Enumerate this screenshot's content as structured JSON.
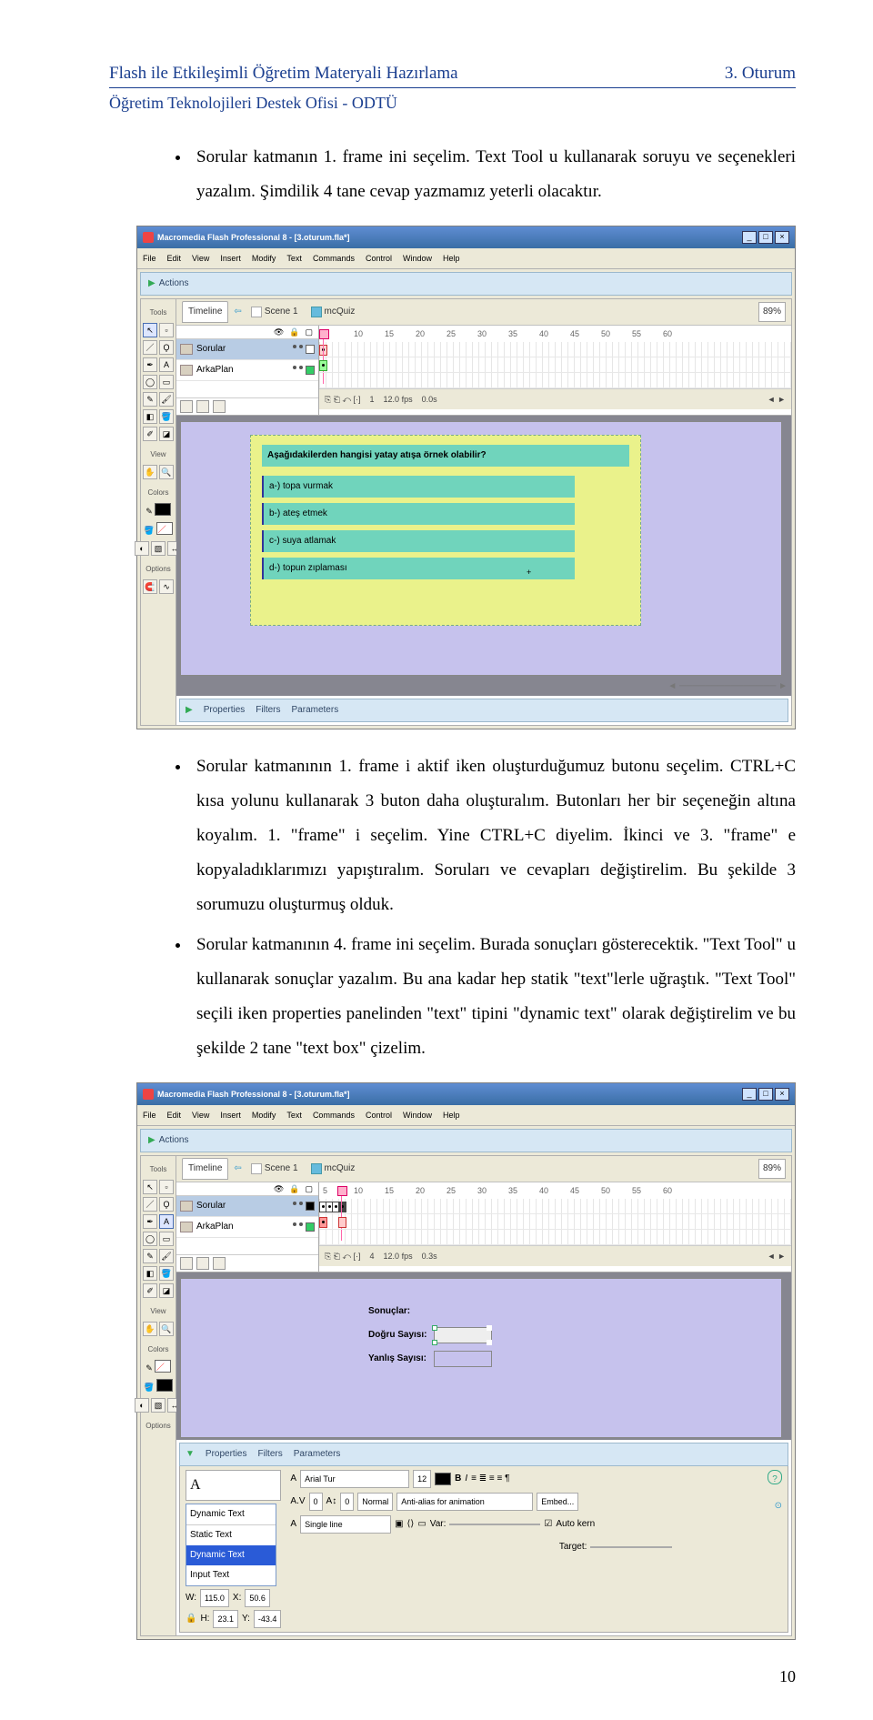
{
  "header": {
    "left": "Flash ile Etkileşimli Öğretim Materyali Hazırlama",
    "right": "3. Oturum",
    "sub": "Öğretim Teknolojileri Destek Ofisi - ODTÜ"
  },
  "body": {
    "p1": "Sorular katmanın 1. frame ini seçelim. Text Tool u kullanarak soruyu ve seçenekleri yazalım. Şimdilik 4 tane cevap yazmamız yeterli olacaktır.",
    "p2": "Sorular katmanının 1. frame i aktif iken oluşturduğumuz butonu seçelim. CTRL+C kısa yolunu kullanarak 3 buton daha oluşturalım. Butonları her bir seçeneğin altına koyalım. 1. \"frame\" i seçelim. Yine CTRL+C diyelim. İkinci ve 3. \"frame\" e kopyaladıklarımızı yapıştıralım. Soruları ve cevapları değiştirelim. Bu şekilde 3 sorumuzu oluşturmuş olduk.",
    "p3": "Sorular katmanının 4. frame ini seçelim. Burada sonuçları gösterecektik. \"Text Tool\" u kullanarak sonuçlar yazalım. Bu ana kadar hep statik \"text\"lerle uğraştık. \"Text Tool\" seçili iken properties panelinden \"text\" tipini \"dynamic text\" olarak değiştirelim ve bu şekilde 2 tane \"text box\" çizelim."
  },
  "ss1": {
    "title": "Macromedia Flash Professional 8 - [3.oturum.fla*]",
    "menus": [
      "File",
      "Edit",
      "View",
      "Insert",
      "Modify",
      "Text",
      "Commands",
      "Control",
      "Window",
      "Help"
    ],
    "actions": "Actions",
    "timeline": "Timeline",
    "scene": "Scene 1",
    "clip": "mcQuiz",
    "zoom": "89%",
    "ruler": [
      "5",
      "10",
      "15",
      "20",
      "25",
      "30",
      "35",
      "40",
      "45",
      "50",
      "55",
      "60"
    ],
    "layers": [
      "Sorular",
      "ArkaPlan"
    ],
    "status": {
      "fr": "1",
      "fps": "12.0 fps",
      "t": "0.0s"
    },
    "tool_sections": {
      "tools": "Tools",
      "view": "View",
      "colors": "Colors",
      "options": "Options"
    },
    "question": "Aşağıdakilerden hangisi yatay atışa örnek olabilir?",
    "opts": [
      "a-) topa vurmak",
      "b-) ateş etmek",
      "c-) suya atlamak",
      "d-) topun zıplaması"
    ],
    "props": [
      "Properties",
      "Filters",
      "Parameters"
    ]
  },
  "ss2": {
    "title": "Macromedia Flash Professional 8 - [3.oturum.fla*]",
    "menus": [
      "File",
      "Edit",
      "View",
      "Insert",
      "Modify",
      "Text",
      "Commands",
      "Control",
      "Window",
      "Help"
    ],
    "actions": "Actions",
    "timeline": "Timeline",
    "scene": "Scene 1",
    "clip": "mcQuiz",
    "zoom": "89%",
    "ruler": [
      "5",
      "10",
      "15",
      "20",
      "25",
      "30",
      "35",
      "40",
      "45",
      "50",
      "55",
      "60"
    ],
    "layers": [
      "Sorular",
      "ArkaPlan"
    ],
    "status": {
      "fr": "4",
      "fps": "12.0 fps",
      "t": "0.3s"
    },
    "tool_sections": {
      "tools": "Tools",
      "view": "View",
      "colors": "Colors",
      "options": "Options"
    },
    "results": {
      "r1": "Sonuçlar:",
      "r2": "Doğru Sayısı:",
      "r3": "Yanlış Sayısı:"
    },
    "props": [
      "Properties",
      "Filters",
      "Parameters"
    ],
    "proppanel": {
      "texttypes": [
        "Dynamic Text",
        "Static Text",
        "Dynamic Text",
        "Input Text"
      ],
      "font": "Arial Tur",
      "size": "12",
      "av": "0",
      "ai": "0",
      "preset": "Normal",
      "anti": "Anti-alias for animation",
      "embed": "Embed...",
      "w": "115.0",
      "x": "50.6",
      "line": "Single line",
      "var": "Var:",
      "autokern": "Auto kern",
      "h": "23.1",
      "y": "-43.4",
      "target": "Target:"
    }
  },
  "page_number": "10"
}
